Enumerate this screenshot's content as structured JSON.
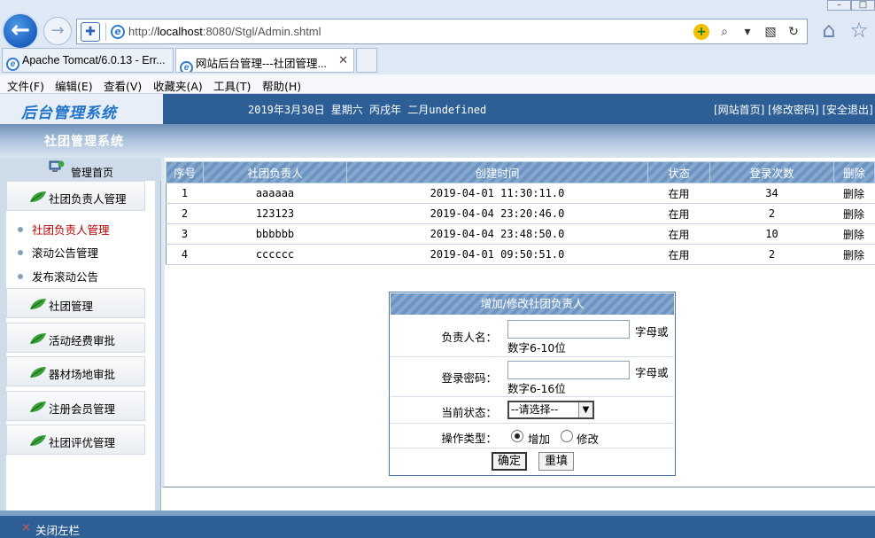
{
  "browser": {
    "url_prefix": "http://",
    "url_host": "localhost",
    "url_rest": ":8080/Stgl/Admin.shtml",
    "tabs": [
      {
        "label": "Apache Tomcat/6.0.13 - Err..."
      },
      {
        "label": "网站后台管理---社团管理...",
        "close": "✕"
      }
    ],
    "menu": [
      "文件(F)",
      "编辑(E)",
      "查看(V)",
      "收藏夹(A)",
      "工具(T)",
      "帮助(H)"
    ]
  },
  "header": {
    "logo": "后台管理系统",
    "date": "2019年3月30日 星期六 丙戌年 二月undefined",
    "links": "[网站首页] [修改密码] [安全退出]",
    "system_title": "社团管理系统"
  },
  "sidebar": {
    "home": "管理首页",
    "groups": [
      {
        "label": "社团负责人管理"
      },
      {
        "label": "社团管理"
      },
      {
        "label": "活动经费审批"
      },
      {
        "label": "器材场地审批"
      },
      {
        "label": "注册会员管理"
      },
      {
        "label": "社团评优管理"
      }
    ],
    "links": [
      {
        "label": "社团负责人管理",
        "active": true
      },
      {
        "label": "滚动公告管理",
        "active": false
      },
      {
        "label": "发布滚动公告",
        "active": false
      }
    ]
  },
  "table": {
    "headers": [
      "序号",
      "社团负责人",
      "创建时间",
      "状态",
      "登录次数",
      "删除"
    ],
    "rows": [
      [
        "1",
        "aaaaaa",
        "2019-04-01 11:30:11.0",
        "在用",
        "34",
        "删除"
      ],
      [
        "2",
        "123123",
        "2019-04-04 23:20:46.0",
        "在用",
        "2",
        "删除"
      ],
      [
        "3",
        "bbbbbb",
        "2019-04-04 23:48:50.0",
        "在用",
        "10",
        "删除"
      ],
      [
        "4",
        "cccccc",
        "2019-04-01 09:50:51.0",
        "在用",
        "2",
        "删除"
      ]
    ]
  },
  "form": {
    "title": "增加/修改社团负责人",
    "name_label": "负责人名：",
    "name_value": "",
    "name_hint_a": "字母或",
    "name_hint_b": "数字6-10位",
    "pwd_label": "登录密码：",
    "pwd_value": "",
    "pwd_hint_a": "字母或",
    "pwd_hint_b": "数字6-16位",
    "status_label": "当前状态：",
    "status_selected": "--请选择--",
    "op_label": "操作类型：",
    "op_add": "增加",
    "op_edit": "修改",
    "op_selected": "增加",
    "submit": "确定",
    "reset": "重填"
  },
  "footer": {
    "close_left": "关闭左栏"
  }
}
